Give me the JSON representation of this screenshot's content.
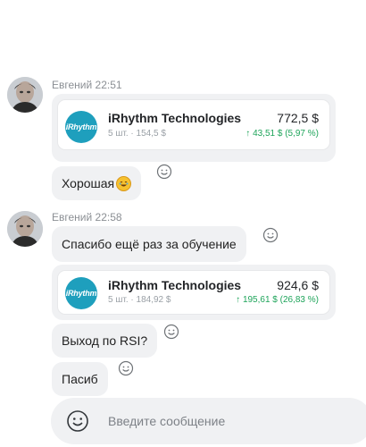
{
  "messages": {
    "group1": {
      "sender": "Евгений",
      "time": "22:51",
      "card": {
        "logo_text": "iRhythm",
        "name": "iRhythm Technologies",
        "quantity": "5 шт.",
        "avg_price": "154,5 $",
        "price": "772,5 $",
        "change": "43,51 $ (5,97 %)"
      },
      "text": "Хорошая"
    },
    "group2": {
      "sender": "Евгений",
      "time": "22:58",
      "text1": "Спасибо ещё раз за обучение",
      "card": {
        "logo_text": "iRhythm",
        "name": "iRhythm Technologies",
        "quantity": "5 шт.",
        "avg_price": "184,92 $",
        "price": "924,6 $",
        "change": "195,61 $ (26,83 %)"
      },
      "text2": "Выход по RSI?",
      "text3": "Пасиб"
    }
  },
  "composer": {
    "placeholder": "Введите сообщение"
  },
  "icons": {
    "reaction": "smiley-outline-icon",
    "composer_emoji": "smiley-icon",
    "laugh_emoji": "rolling-laughing-emoji",
    "up_arrow": "arrow-up-icon"
  },
  "colors": {
    "bubble_bg": "#f0f1f3",
    "positive": "#1ea45a",
    "logo_bg": "#1e9fbd"
  }
}
